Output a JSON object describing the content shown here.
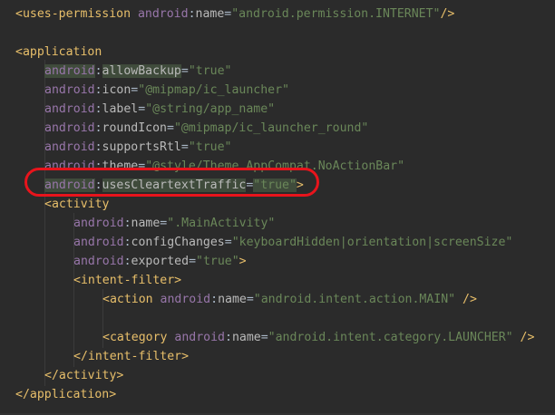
{
  "lines": [
    {
      "indent": 0,
      "tokens": [
        {
          "t": "tag",
          "v": "<uses-permission "
        },
        {
          "t": "ns",
          "v": "android"
        },
        {
          "t": "eq",
          "v": ":"
        },
        {
          "t": "attr",
          "v": "name"
        },
        {
          "t": "eq",
          "v": "="
        },
        {
          "t": "str",
          "v": "\"android.permission.INTERNET\""
        },
        {
          "t": "tag",
          "v": "/>"
        }
      ]
    },
    {
      "indent": 0,
      "tokens": []
    },
    {
      "indent": 0,
      "tokens": [
        {
          "t": "tag",
          "v": "<application"
        }
      ]
    },
    {
      "indent": 1,
      "tokens": [
        {
          "t": "ns",
          "v": "android",
          "hl": true
        },
        {
          "t": "eq",
          "v": ":"
        },
        {
          "t": "attr",
          "v": "allowBackup",
          "hl": true
        },
        {
          "t": "eq",
          "v": "="
        },
        {
          "t": "str",
          "v": "\"true\""
        }
      ]
    },
    {
      "indent": 1,
      "tokens": [
        {
          "t": "ns",
          "v": "android"
        },
        {
          "t": "eq",
          "v": ":"
        },
        {
          "t": "attr",
          "v": "icon"
        },
        {
          "t": "eq",
          "v": "="
        },
        {
          "t": "str",
          "v": "\"@mipmap/ic_launcher\""
        }
      ]
    },
    {
      "indent": 1,
      "tokens": [
        {
          "t": "ns",
          "v": "android"
        },
        {
          "t": "eq",
          "v": ":"
        },
        {
          "t": "attr",
          "v": "label"
        },
        {
          "t": "eq",
          "v": "="
        },
        {
          "t": "str",
          "v": "\"@string/app_name\""
        }
      ]
    },
    {
      "indent": 1,
      "tokens": [
        {
          "t": "ns",
          "v": "android"
        },
        {
          "t": "eq",
          "v": ":"
        },
        {
          "t": "attr",
          "v": "roundIcon"
        },
        {
          "t": "eq",
          "v": "="
        },
        {
          "t": "str",
          "v": "\"@mipmap/ic_launcher_round\""
        }
      ]
    },
    {
      "indent": 1,
      "tokens": [
        {
          "t": "ns",
          "v": "android"
        },
        {
          "t": "eq",
          "v": ":"
        },
        {
          "t": "attr",
          "v": "supportsRtl"
        },
        {
          "t": "eq",
          "v": "="
        },
        {
          "t": "str",
          "v": "\"true\""
        }
      ]
    },
    {
      "indent": 1,
      "tokens": [
        {
          "t": "ns",
          "v": "android"
        },
        {
          "t": "eq",
          "v": ":"
        },
        {
          "t": "attr",
          "v": "theme"
        },
        {
          "t": "eq",
          "v": "="
        },
        {
          "t": "str",
          "v": "\"@style/Theme.AppCompat.NoActionBar\""
        }
      ]
    },
    {
      "indent": 1,
      "tokens": [
        {
          "t": "ns",
          "v": "android",
          "hl": true
        },
        {
          "t": "eq",
          "v": ":"
        },
        {
          "t": "attr",
          "v": "usesCleartextTraffic",
          "hl": true
        },
        {
          "t": "eq",
          "v": "="
        },
        {
          "t": "str",
          "v": "\"true\"",
          "hl": true
        },
        {
          "t": "tag",
          "v": ">"
        }
      ]
    },
    {
      "indent": 1,
      "tokens": [
        {
          "t": "tag",
          "v": "<activity"
        }
      ]
    },
    {
      "indent": 2,
      "tokens": [
        {
          "t": "ns",
          "v": "android"
        },
        {
          "t": "eq",
          "v": ":"
        },
        {
          "t": "attr",
          "v": "name"
        },
        {
          "t": "eq",
          "v": "="
        },
        {
          "t": "str",
          "v": "\".MainActivity\""
        }
      ]
    },
    {
      "indent": 2,
      "tokens": [
        {
          "t": "ns",
          "v": "android"
        },
        {
          "t": "eq",
          "v": ":"
        },
        {
          "t": "attr",
          "v": "configChanges"
        },
        {
          "t": "eq",
          "v": "="
        },
        {
          "t": "str",
          "v": "\"keyboardHidden|orientation|screenSize\""
        }
      ]
    },
    {
      "indent": 2,
      "tokens": [
        {
          "t": "ns",
          "v": "android"
        },
        {
          "t": "eq",
          "v": ":"
        },
        {
          "t": "attr",
          "v": "exported"
        },
        {
          "t": "eq",
          "v": "="
        },
        {
          "t": "str",
          "v": "\"true\""
        },
        {
          "t": "tag",
          "v": ">"
        }
      ]
    },
    {
      "indent": 2,
      "tokens": [
        {
          "t": "tag",
          "v": "<intent-filter>"
        }
      ]
    },
    {
      "indent": 3,
      "tokens": [
        {
          "t": "tag",
          "v": "<action "
        },
        {
          "t": "ns",
          "v": "android"
        },
        {
          "t": "eq",
          "v": ":"
        },
        {
          "t": "attr",
          "v": "name"
        },
        {
          "t": "eq",
          "v": "="
        },
        {
          "t": "str",
          "v": "\"android.intent.action.MAIN\""
        },
        {
          "t": "tag",
          "v": " />"
        }
      ]
    },
    {
      "indent": 3,
      "tokens": []
    },
    {
      "indent": 3,
      "tokens": [
        {
          "t": "tag",
          "v": "<category "
        },
        {
          "t": "ns",
          "v": "android"
        },
        {
          "t": "eq",
          "v": ":"
        },
        {
          "t": "attr",
          "v": "name"
        },
        {
          "t": "eq",
          "v": "="
        },
        {
          "t": "str",
          "v": "\"android.intent.category.LAUNCHER\""
        },
        {
          "t": "tag",
          "v": " />"
        }
      ]
    },
    {
      "indent": 2,
      "tokens": [
        {
          "t": "tag",
          "v": "</intent-filter>"
        }
      ]
    },
    {
      "indent": 1,
      "tokens": [
        {
          "t": "tag",
          "v": "</activity>"
        }
      ]
    },
    {
      "indent": 0,
      "tokens": [
        {
          "t": "tag",
          "v": "</application>"
        }
      ]
    }
  ],
  "colors": {
    "background": "#2b2b2b",
    "tag": "#e8bf6a",
    "namespace": "#9876aa",
    "attribute": "#bababa",
    "string": "#6a8759",
    "highlight": "#3f4b3b",
    "annotation_circle": "#e8141c"
  }
}
